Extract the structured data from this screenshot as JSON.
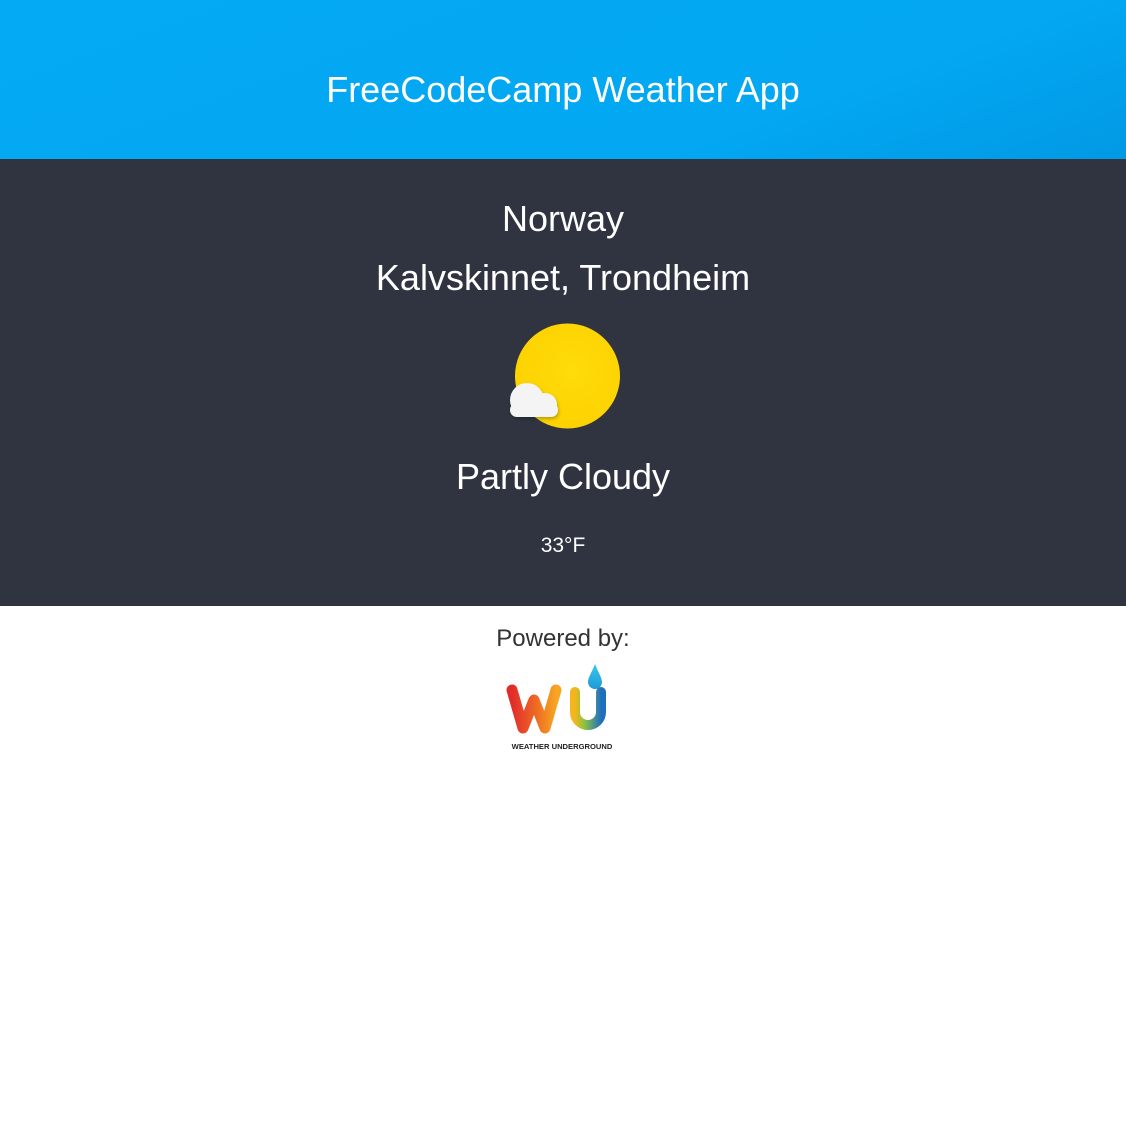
{
  "header": {
    "title": "FreeCodeCamp Weather App",
    "background": "#04aaf3"
  },
  "weather": {
    "country": "Norway",
    "location": "Kalvskinnet, Trondheim",
    "icon": "partly-cloudy-icon",
    "condition": "Partly Cloudy",
    "temperature": "33°F",
    "panel_background": "#2f3440"
  },
  "footer": {
    "powered_by_label": "Powered by:",
    "logo": "weather-underground-logo",
    "logo_text": "WEATHER UNDERGROUND"
  }
}
